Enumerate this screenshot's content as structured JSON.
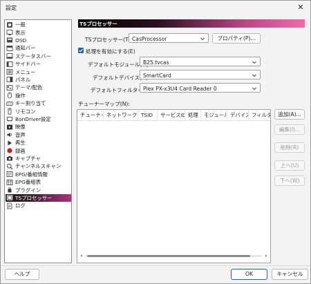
{
  "window": {
    "title": "設定"
  },
  "sidebar": {
    "items": [
      {
        "label": "一般",
        "icon": "general-icon"
      },
      {
        "label": "表示",
        "icon": "display-icon"
      },
      {
        "label": "OSD",
        "icon": "osd-icon"
      },
      {
        "label": "通知バー",
        "icon": "notification-bar-icon"
      },
      {
        "label": "ステータスバー",
        "icon": "statusbar-icon"
      },
      {
        "label": "サイドバー",
        "icon": "sidebar-icon"
      },
      {
        "label": "メニュー",
        "icon": "menu-icon"
      },
      {
        "label": "パネル",
        "icon": "panel-icon"
      },
      {
        "label": "テーマ/配色",
        "icon": "theme-icon"
      },
      {
        "label": "操作",
        "icon": "mouse-icon"
      },
      {
        "label": "キー割り当て",
        "icon": "keyboard-icon"
      },
      {
        "label": "リモコン",
        "icon": "remote-icon"
      },
      {
        "label": "BonDriver設定",
        "icon": "bondriver-icon"
      },
      {
        "label": "映像",
        "icon": "video-icon"
      },
      {
        "label": "音声",
        "icon": "speaker-icon"
      },
      {
        "label": "再生",
        "icon": "play-icon"
      },
      {
        "label": "録画",
        "icon": "record-icon"
      },
      {
        "label": "キャプチャ",
        "icon": "camera-icon"
      },
      {
        "label": "チャンネルスキャン",
        "icon": "channel-scan-icon"
      },
      {
        "label": "EPG/番組情報",
        "icon": "epg-icon"
      },
      {
        "label": "EPG番組表",
        "icon": "program-guide-icon"
      },
      {
        "label": "プラグイン",
        "icon": "plugin-icon"
      },
      {
        "label": "TSプロセッサー",
        "icon": "ts-processor-icon"
      },
      {
        "label": "ログ",
        "icon": "log-icon"
      }
    ],
    "selected_index": 22
  },
  "page": {
    "header": "TSプロセッサー",
    "ts_processor_label": "TSプロセッサー(T):",
    "ts_processor_value": "CasProcessor",
    "properties_button": "プロパティ(P)...",
    "enable_checkbox_label": "処理を有効にする(E)",
    "enable_checked": true,
    "default_module_label": "デフォルトモジュール(M):",
    "default_module_value": "B25.tvcas",
    "default_device_label": "デフォルトデバイス(D):",
    "default_device_value": "SmartCard",
    "default_filter_label": "デフォルトフィルター(F):",
    "default_filter_value": "Plex PX-x3U4 Card Reader 0",
    "tuner_map_label": "チューナーマップ(N):",
    "tuner_map_columns": [
      "チューナー",
      "ネットワークID",
      "TSID",
      "サービスID",
      "処理",
      "モジュール",
      "デバイス",
      "フィルター"
    ],
    "add_button": "追加(A)...",
    "edit_button": "編集(I)...",
    "delete_button": "削除(R)",
    "up_button": "上へ(U)",
    "down_button": "下へ(W)"
  },
  "footer": {
    "help_button": "ヘルプ",
    "ok_button": "OK",
    "cancel_button": "キャンセル"
  },
  "colors": {
    "accent": "#1f66c4",
    "header_gradient_end": "#f06aa8"
  }
}
